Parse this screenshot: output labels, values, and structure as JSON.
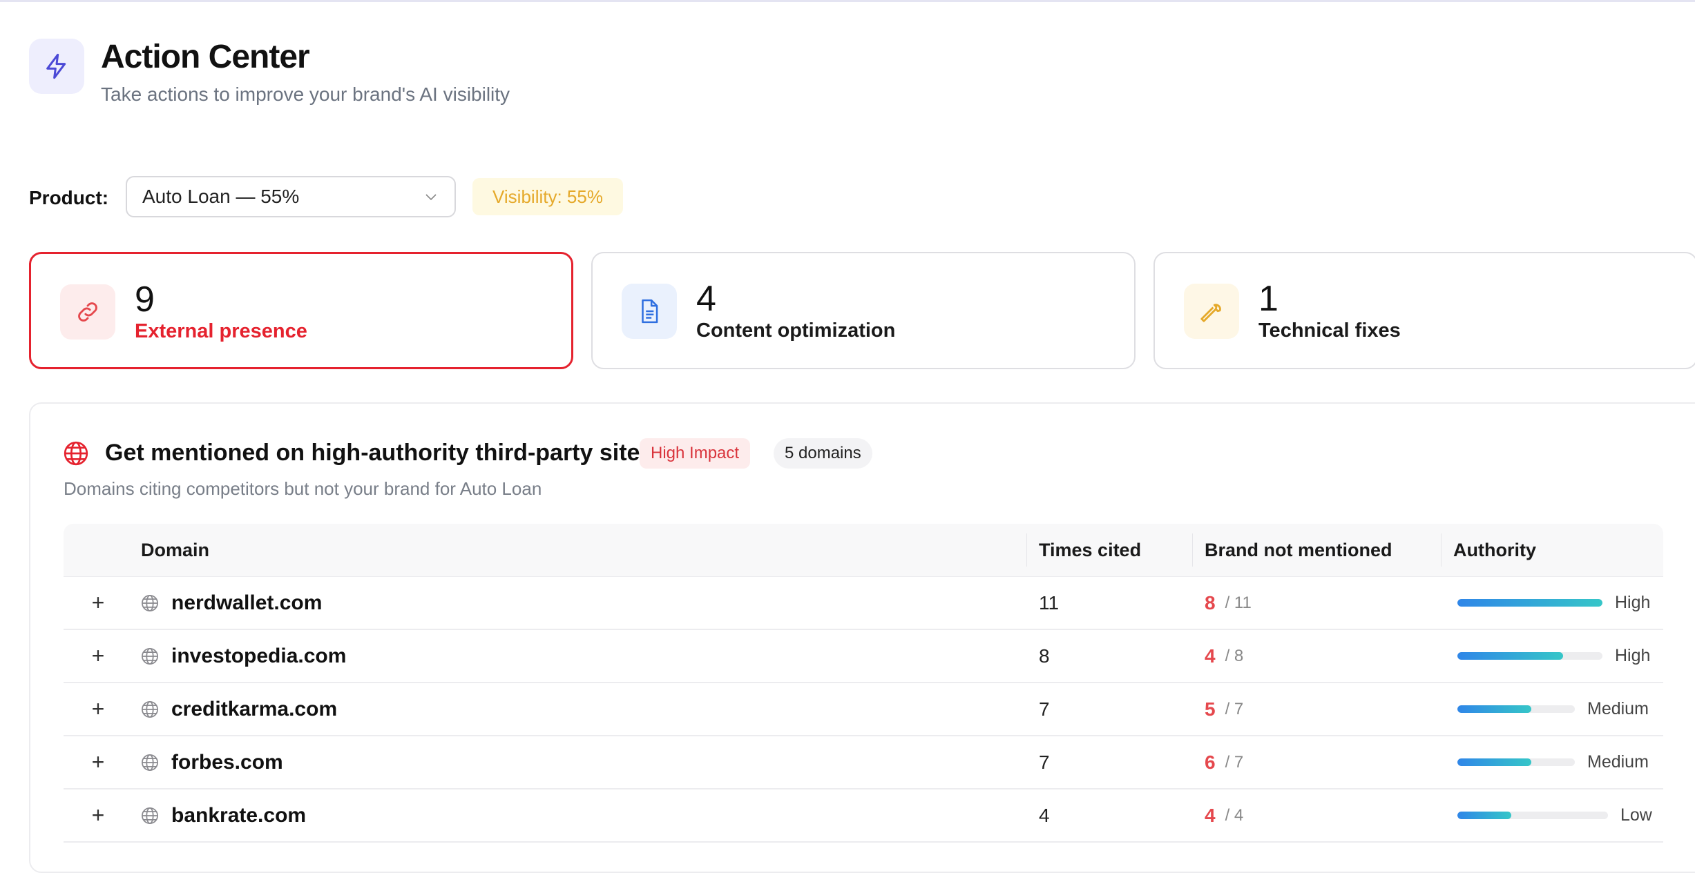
{
  "header": {
    "title": "Action Center",
    "subtitle": "Take actions to improve your brand's AI visibility",
    "icon": "lightning-icon"
  },
  "product": {
    "label": "Product:",
    "selected": "Auto Loan — 55%",
    "visibility": "Visibility: 55%"
  },
  "stats": [
    {
      "value": "9",
      "label": "External presence",
      "icon": "link-icon",
      "active": true
    },
    {
      "value": "4",
      "label": "Content optimization",
      "icon": "document-icon",
      "active": false
    },
    {
      "value": "1",
      "label": "Technical fixes",
      "icon": "wrench-icon",
      "active": false
    }
  ],
  "panel": {
    "title": "Get mentioned on high-authority third-party sites",
    "impact": "High Impact",
    "domains_count": "5 domains",
    "subtitle": "Domains citing competitors but not your brand for Auto Loan"
  },
  "table": {
    "headers": {
      "domain": "Domain",
      "times_cited": "Times cited",
      "brand_not_mentioned": "Brand not mentioned",
      "authority": "Authority"
    },
    "rows": [
      {
        "domain": "nerdwallet.com",
        "times": "11",
        "brand_num": "8",
        "brand_total": "/ 11",
        "authority": "High",
        "authority_pct": 100
      },
      {
        "domain": "investopedia.com",
        "times": "8",
        "brand_num": "4",
        "brand_total": "/ 8",
        "authority": "High",
        "authority_pct": 73
      },
      {
        "domain": "creditkarma.com",
        "times": "7",
        "brand_num": "5",
        "brand_total": "/ 7",
        "authority": "Medium",
        "authority_pct": 63
      },
      {
        "domain": "forbes.com",
        "times": "7",
        "brand_num": "6",
        "brand_total": "/ 7",
        "authority": "Medium",
        "authority_pct": 63
      },
      {
        "domain": "bankrate.com",
        "times": "4",
        "brand_num": "4",
        "brand_total": "/ 4",
        "authority": "Low",
        "authority_pct": 36
      }
    ]
  },
  "colors": {
    "accent_red": "#e5222e",
    "visibility_text": "#e5a92a",
    "bar_gradient_start": "#2f86e8",
    "bar_gradient_end": "#36c6c8"
  }
}
